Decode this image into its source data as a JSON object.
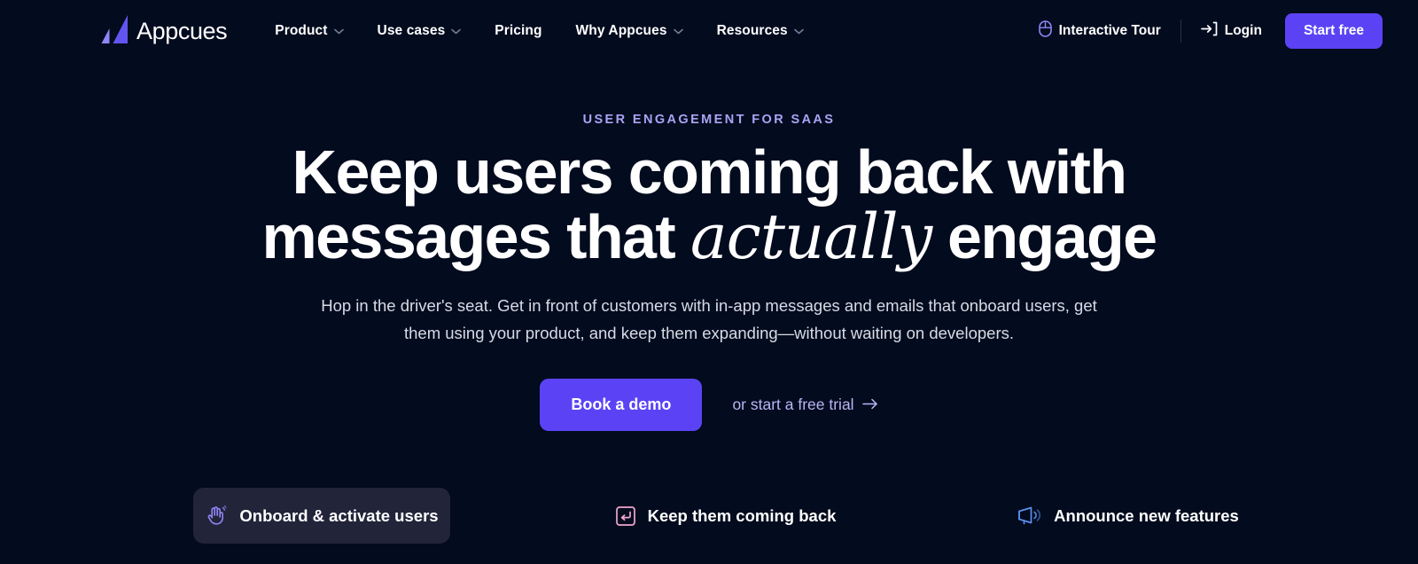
{
  "theme": {
    "background": "#030b1e",
    "accent_purple": "#5b43f5",
    "eyebrow_color": "#a9a4f5",
    "link_color": "#b9b6f7",
    "active_tab_bg": "#22243a",
    "icon_pink": "#f0a8cd",
    "icon_blue": "#5b8ff0"
  },
  "nav": {
    "logo": {
      "name": "Appcues",
      "mark_icon": "appcues-logo-mark"
    },
    "links": [
      {
        "label": "Product",
        "has_dropdown": true
      },
      {
        "label": "Use cases",
        "has_dropdown": true
      },
      {
        "label": "Pricing",
        "has_dropdown": false
      },
      {
        "label": "Why Appcues",
        "has_dropdown": true
      },
      {
        "label": "Resources",
        "has_dropdown": true
      }
    ],
    "interactive_tour": {
      "label": "Interactive Tour",
      "icon": "mouse-icon"
    },
    "login": {
      "label": "Login",
      "icon": "login-arrow-icon"
    },
    "start_free": {
      "label": "Start free"
    }
  },
  "hero": {
    "eyebrow": "USER ENGAGEMENT FOR SAAS",
    "headline_line1": "Keep users coming back with",
    "headline_line2_before": "messages that ",
    "headline_line2_italic": "actually",
    "headline_line2_after": " engage",
    "subcopy": "Hop in the driver's seat. Get in front of customers with in-app messages and emails that onboard users, get them using your product, and keep them expanding—without waiting on developers.",
    "primary_cta": "Book a demo",
    "secondary_cta": "or start a free trial"
  },
  "tabs": [
    {
      "label": "Onboard & activate users",
      "icon": "waving-hand-icon",
      "active": true
    },
    {
      "label": "Keep them coming back",
      "icon": "return-key-icon",
      "active": false
    },
    {
      "label": "Announce new features",
      "icon": "megaphone-icon",
      "active": false
    }
  ]
}
